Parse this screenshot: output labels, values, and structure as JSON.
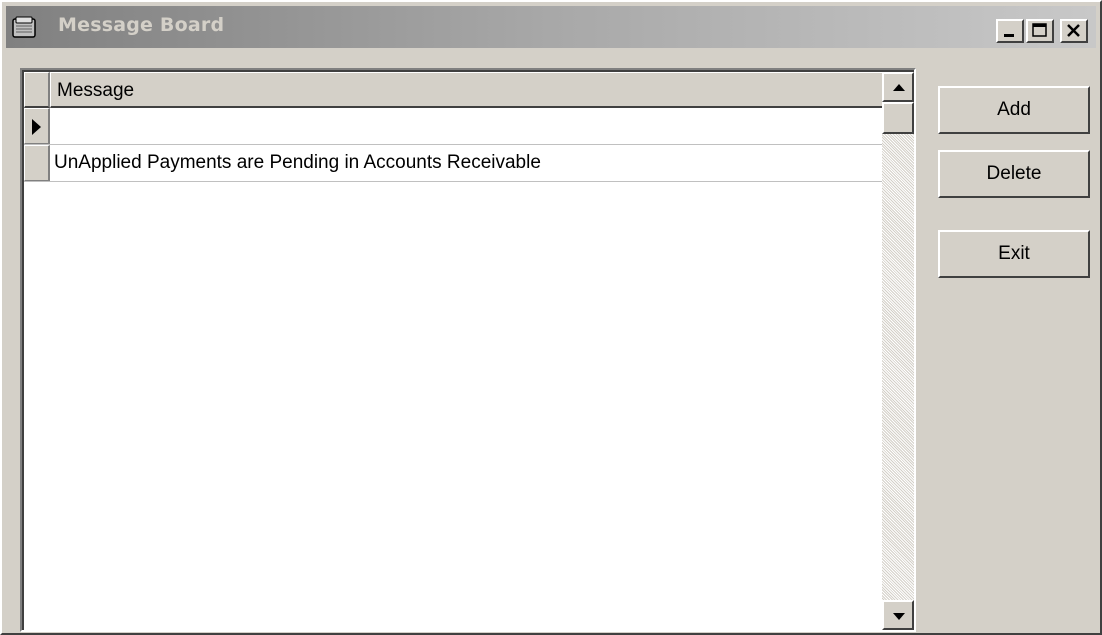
{
  "window": {
    "title": "Message Board",
    "icon": "clipboard-icon"
  },
  "title_controls": {
    "minimize_icon": "minimize-icon",
    "maximize_icon": "maximize-icon",
    "close_icon": "close-icon"
  },
  "grid": {
    "column_header": "Message",
    "current_row_icon": "row-pointer-icon",
    "rows": [
      {
        "message": ""
      },
      {
        "message": "UnApplied Payments are Pending in Accounts Receivable"
      }
    ]
  },
  "scrollbar": {
    "up_icon": "scroll-up-arrow-icon",
    "down_icon": "scroll-down-arrow-icon"
  },
  "actions": {
    "add_label": "Add",
    "delete_label": "Delete",
    "exit_label": "Exit"
  },
  "colors": {
    "face": "#d4d0c8",
    "titlebar_inactive_start": "#808080",
    "titlebar_inactive_end": "#c8c8c8",
    "grid_background": "#ffffff"
  }
}
